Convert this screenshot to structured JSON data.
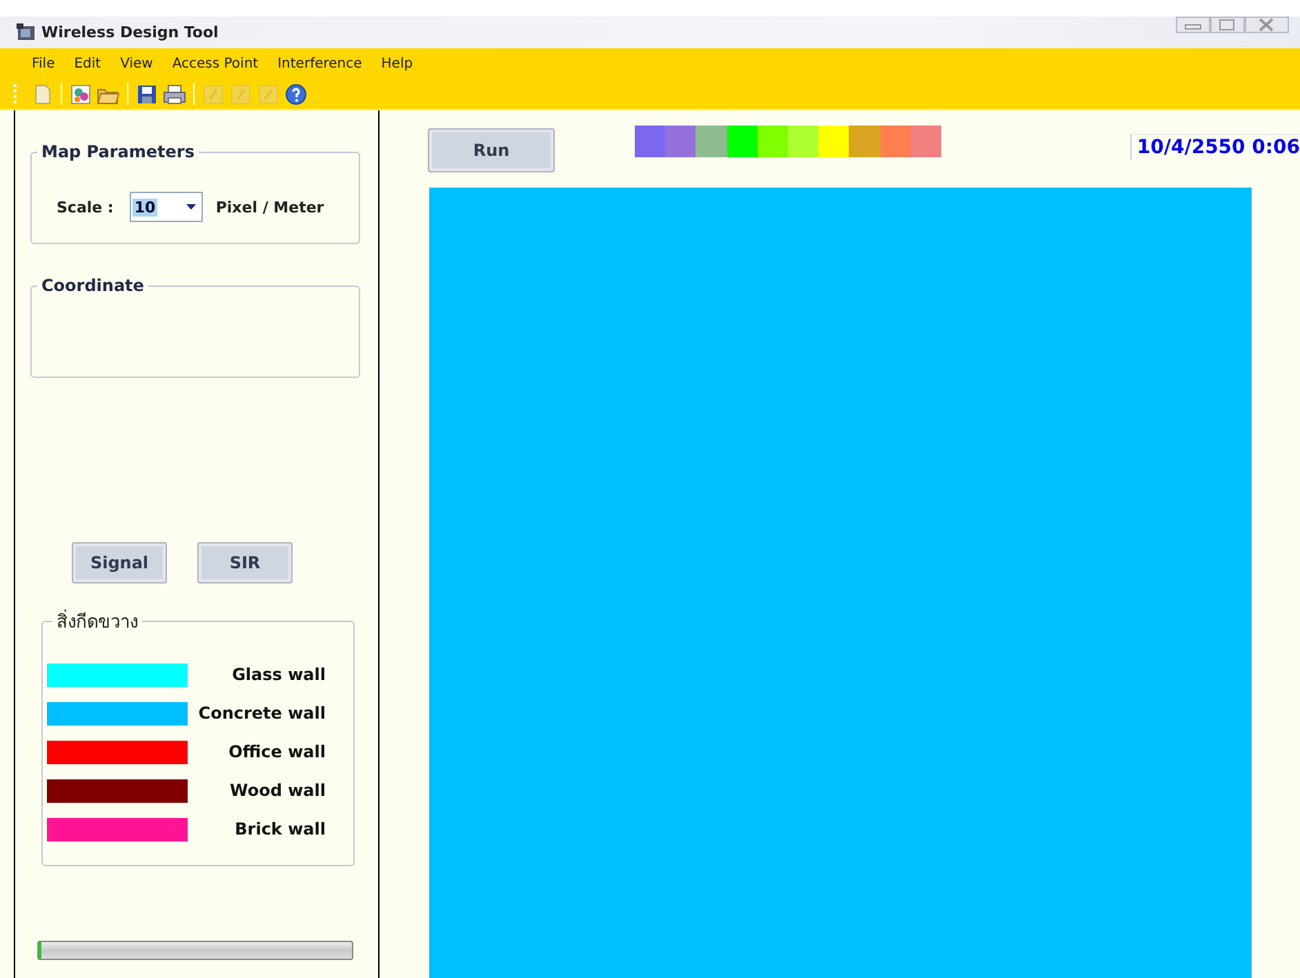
{
  "window": {
    "title": "Wireless Design Tool"
  },
  "menu": [
    "File",
    "Edit",
    "View",
    "Access Point",
    "Interference",
    "Help"
  ],
  "toolbar": [
    {
      "kind": "new",
      "disabled": false
    },
    {
      "kind": "sep"
    },
    {
      "kind": "picture",
      "disabled": false
    },
    {
      "kind": "open",
      "disabled": false
    },
    {
      "kind": "sep"
    },
    {
      "kind": "save",
      "disabled": false
    },
    {
      "kind": "print",
      "disabled": false
    },
    {
      "kind": "sep"
    },
    {
      "kind": "tool",
      "disabled": true
    },
    {
      "kind": "tool",
      "disabled": true
    },
    {
      "kind": "tool",
      "disabled": true
    },
    {
      "kind": "help",
      "disabled": false
    }
  ],
  "map_parameters": {
    "title": "Map Parameters",
    "scale_label": "Scale :",
    "scale_value": "10",
    "unit": "Pixel / Meter"
  },
  "coordinate": {
    "title": "Coordinate"
  },
  "view_buttons": [
    "Signal",
    "SIR"
  ],
  "obstacles": {
    "title": "สิ่งกีดขวาง",
    "items": [
      {
        "label": "Glass wall",
        "color": "#00ffff"
      },
      {
        "label": "Concrete wall",
        "color": "#00bfff"
      },
      {
        "label": "Office wall",
        "color": "#ff0000"
      },
      {
        "label": "Wood wall",
        "color": "#800000"
      },
      {
        "label": "Brick wall",
        "color": "#ff1493"
      }
    ]
  },
  "progress": {
    "level": 0.01
  },
  "run_button": "Run",
  "color_scale": [
    {
      "color": "#7b68ee"
    },
    {
      "color": "#9370db"
    },
    {
      "color": "#8fbc8f"
    },
    {
      "color": "#00ff00"
    },
    {
      "color": "#7fff00"
    },
    {
      "color": "#adff2f"
    },
    {
      "color": "#ffff00"
    },
    {
      "color": "#daa520"
    },
    {
      "color": "#ff7f50"
    },
    {
      "color": "#f08080"
    }
  ],
  "date": "10/4/2550 0:06",
  "map_area": {
    "color": "#00bfff"
  }
}
